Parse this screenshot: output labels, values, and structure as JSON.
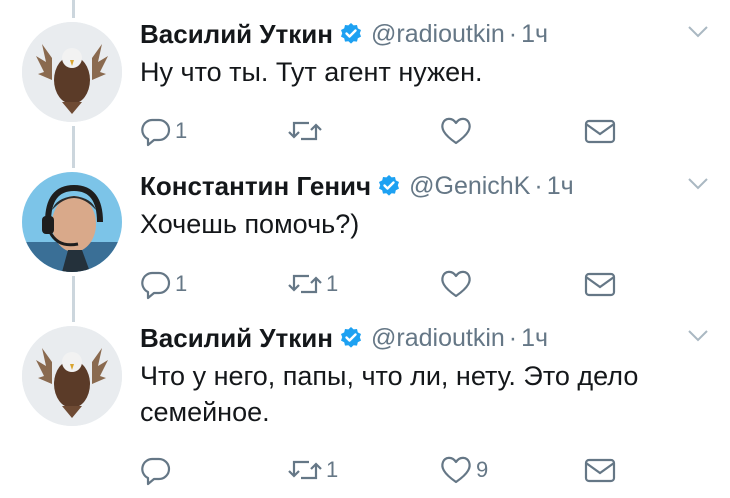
{
  "colors": {
    "verified": "#1da1f2",
    "secondary": "#657786",
    "thread_line": "#ccd6dd"
  },
  "tweets": [
    {
      "name": "Василий Уткин",
      "handle": "@radioutkin",
      "separator": "·",
      "time": "1ч",
      "text": "Ну что ты. Тут агент нужен.",
      "reply_count": "1",
      "retweet_count": "",
      "like_count": "",
      "avatar": "eagle-avatar"
    },
    {
      "name": "Константин Генич",
      "handle": "@GenichK",
      "separator": "·",
      "time": "1ч",
      "text": "Хочешь помочь?)",
      "reply_count": "1",
      "retweet_count": "1",
      "like_count": "",
      "avatar": "headset-person-avatar"
    },
    {
      "name": "Василий Уткин",
      "handle": "@radioutkin",
      "separator": "·",
      "time": "1ч",
      "text": "Что у него, папы, что ли, нету. Это дело семейное.",
      "reply_count": "",
      "retweet_count": "1",
      "like_count": "9",
      "avatar": "eagle-avatar"
    }
  ]
}
